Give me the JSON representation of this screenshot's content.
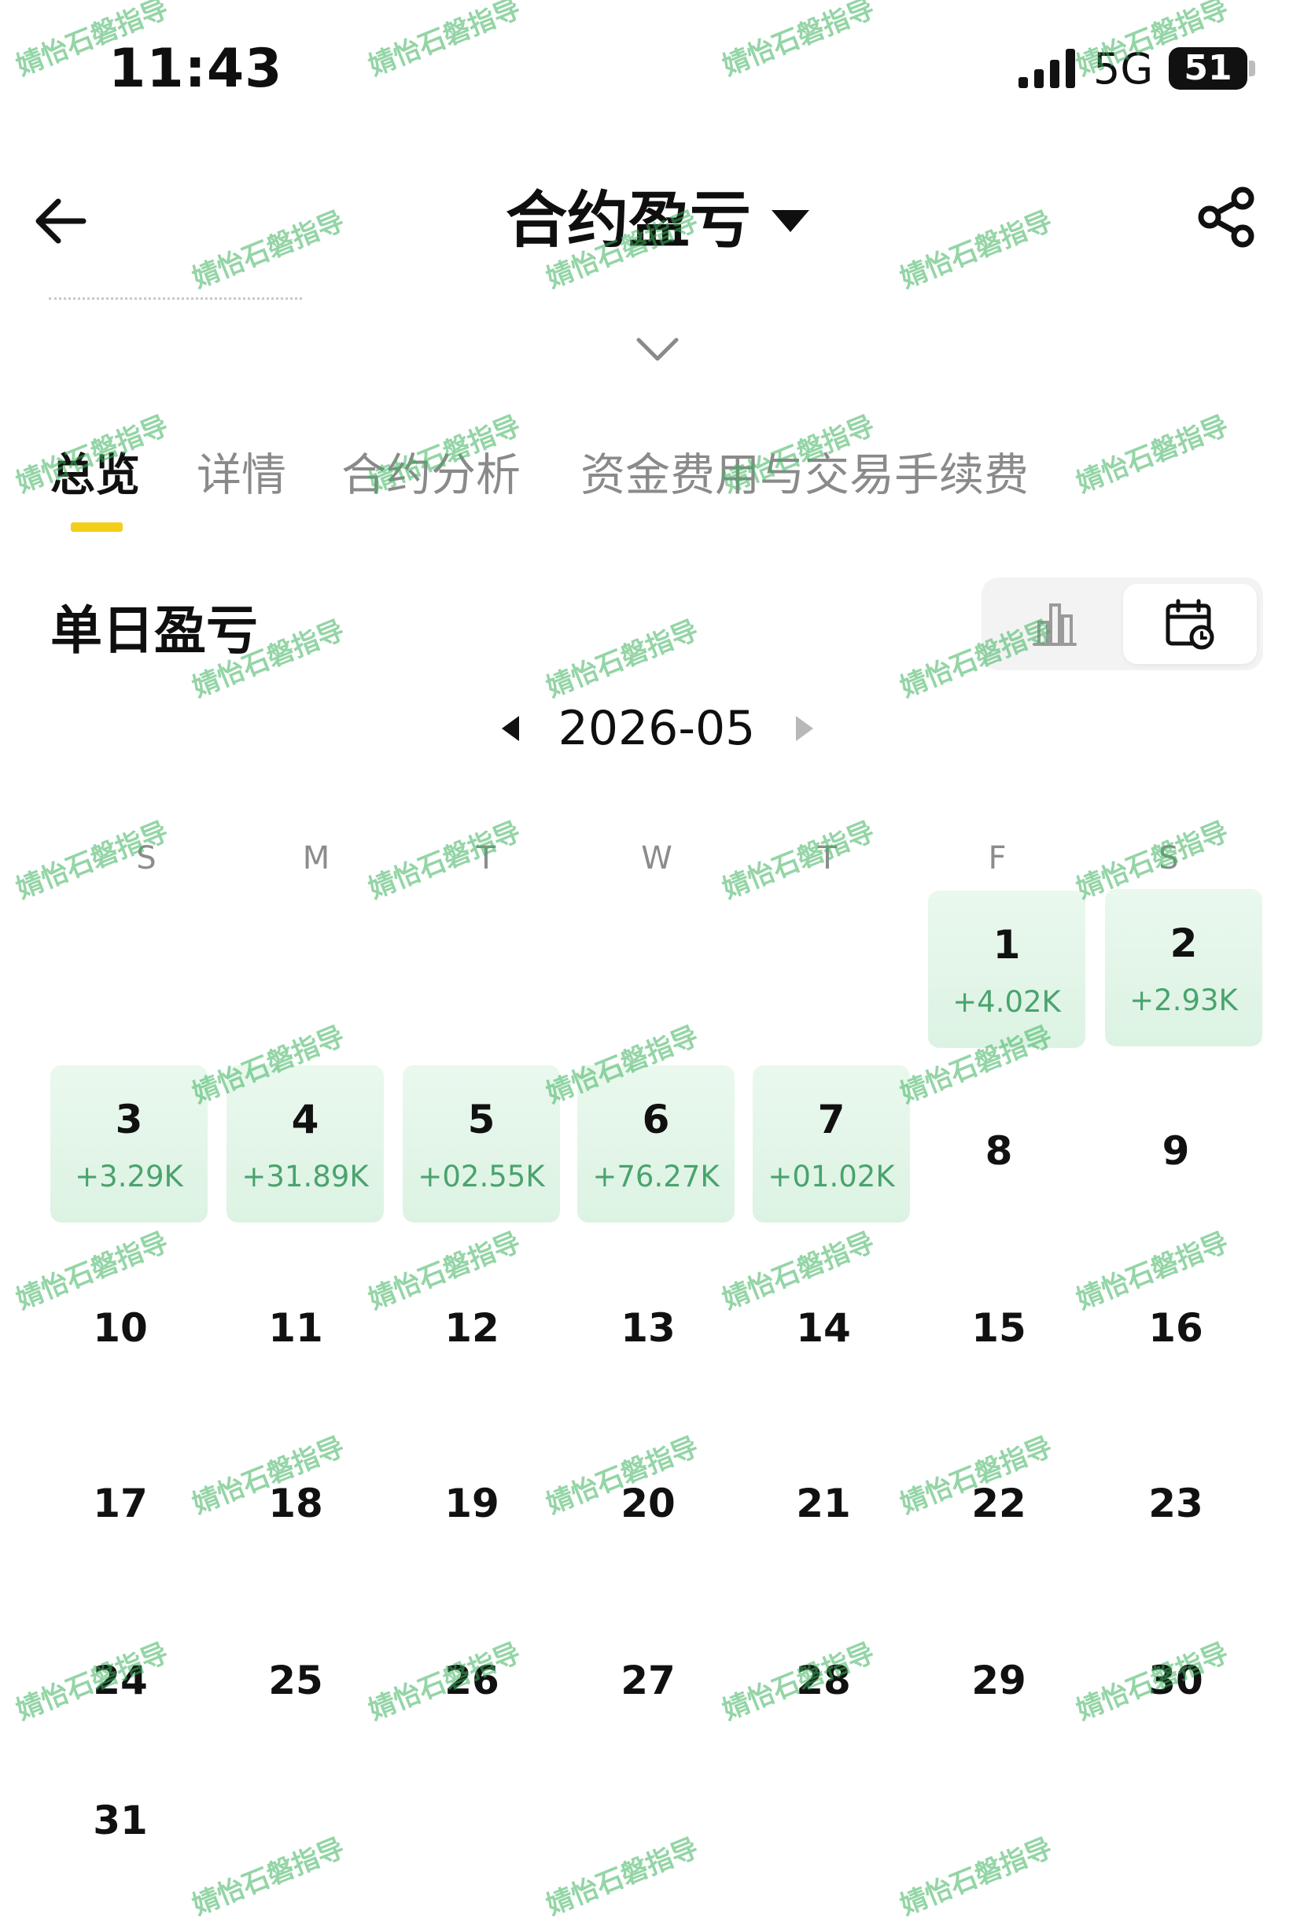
{
  "status_bar": {
    "time": "11:43",
    "network": "5G",
    "battery": "51"
  },
  "header": {
    "title": "合约盈亏"
  },
  "tabs": [
    {
      "label": "总览",
      "active": true
    },
    {
      "label": "详情",
      "active": false
    },
    {
      "label": "合约分析",
      "active": false
    },
    {
      "label": "资金费用与交易手续费",
      "active": false
    }
  ],
  "section": {
    "title": "单日盈亏",
    "view_toggle": {
      "options": [
        "bar-chart-icon",
        "calendar-icon"
      ],
      "selected": "calendar-icon"
    }
  },
  "calendar": {
    "month": "2026-05",
    "weekdays": [
      "S",
      "M",
      "T",
      "W",
      "T",
      "F",
      "S"
    ],
    "days": [
      {
        "day": "1",
        "pnl": "+4.02K"
      },
      {
        "day": "2",
        "pnl": "+2.93K"
      },
      {
        "day": "3",
        "pnl": "+3.29K"
      },
      {
        "day": "4",
        "pnl": "+31.89K"
      },
      {
        "day": "5",
        "pnl": "+02.55K"
      },
      {
        "day": "6",
        "pnl": "+76.27K"
      },
      {
        "day": "7",
        "pnl": "+01.02K"
      },
      {
        "day": "8"
      },
      {
        "day": "9"
      },
      {
        "day": "10"
      },
      {
        "day": "11"
      },
      {
        "day": "12"
      },
      {
        "day": "13"
      },
      {
        "day": "14"
      },
      {
        "day": "15"
      },
      {
        "day": "16"
      },
      {
        "day": "17"
      },
      {
        "day": "18"
      },
      {
        "day": "19"
      },
      {
        "day": "20"
      },
      {
        "day": "21"
      },
      {
        "day": "22"
      },
      {
        "day": "23"
      },
      {
        "day": "24"
      },
      {
        "day": "25"
      },
      {
        "day": "26"
      },
      {
        "day": "27"
      },
      {
        "day": "28"
      },
      {
        "day": "29"
      },
      {
        "day": "30"
      },
      {
        "day": "31"
      }
    ],
    "positive_color": "#4aa36e",
    "highlight_color": "#e2f5e8"
  },
  "accent_color": "#f3cf1a",
  "watermark": "婧怡石磐指导"
}
